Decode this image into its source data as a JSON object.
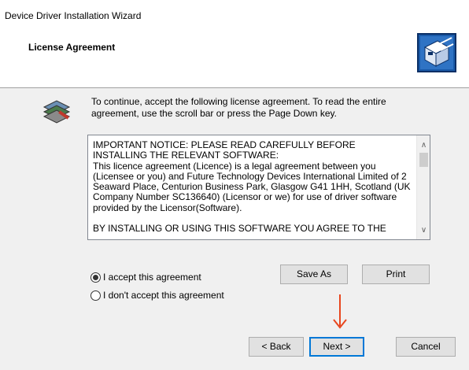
{
  "window": {
    "title": "Device Driver Installation Wizard"
  },
  "header": {
    "title": "License Agreement",
    "icon": "installer-box-icon"
  },
  "body": {
    "icon": "software-stack-icon",
    "intro": "To continue, accept the following license agreement. To read the entire agreement, use the scroll bar or press the Page Down key.",
    "license": {
      "para1": "IMPORTANT NOTICE: PLEASE READ CAREFULLY BEFORE INSTALLING THE RELEVANT SOFTWARE:",
      "para2": "This licence agreement (Licence) is a legal agreement between you (Licensee or you) and Future Technology Devices International Limited of 2 Seaward Place, Centurion Business Park, Glasgow G41 1HH, Scotland (UK Company Number SC136640) (Licensor or we) for use of driver software provided by the Licensor(Software).",
      "para3": "BY INSTALLING OR USING THIS SOFTWARE YOU AGREE TO THE"
    },
    "buttons": {
      "save_as": "Save As",
      "print": "Print"
    },
    "radios": {
      "accept": {
        "label": "I accept this agreement",
        "checked": true
      },
      "decline": {
        "label": "I don't accept this agreement",
        "checked": false
      }
    }
  },
  "footer": {
    "back": "< Back",
    "next": "Next >",
    "cancel": "Cancel",
    "focused": "next"
  },
  "colors": {
    "arrow": "#e8461e",
    "focus": "#0078d7"
  }
}
